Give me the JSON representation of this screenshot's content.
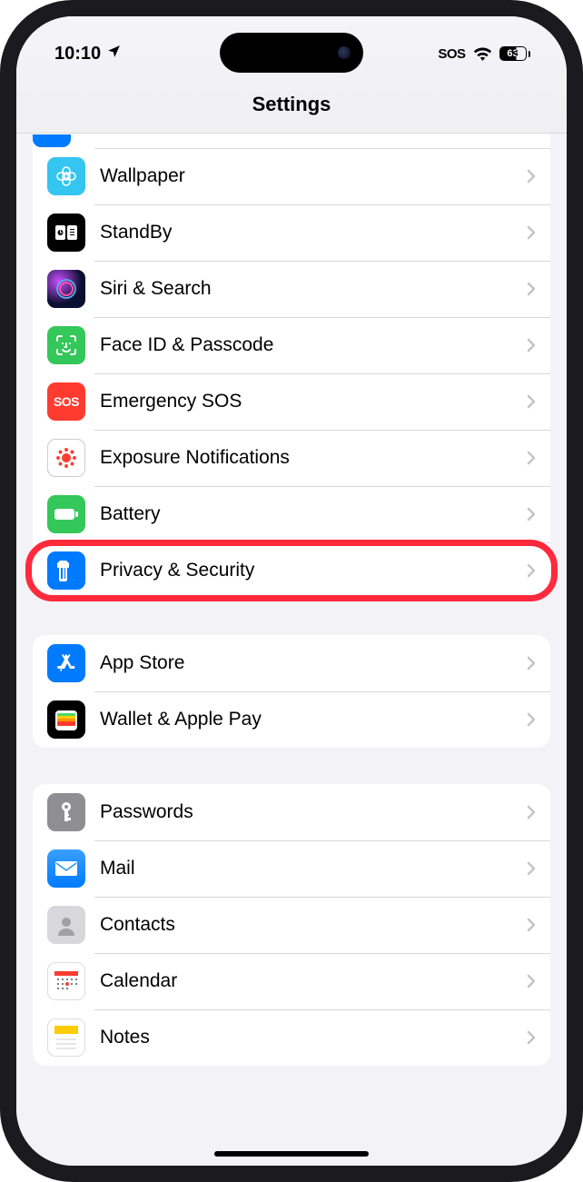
{
  "status": {
    "time": "10:10",
    "sos": "SOS",
    "battery": "63"
  },
  "header": {
    "title": "Settings"
  },
  "groups": [
    {
      "items": [
        {
          "label": "Wallpaper",
          "icon": "wallpaper-icon"
        },
        {
          "label": "StandBy",
          "icon": "standby-icon"
        },
        {
          "label": "Siri & Search",
          "icon": "siri-icon"
        },
        {
          "label": "Face ID & Passcode",
          "icon": "faceid-icon"
        },
        {
          "label": "Emergency SOS",
          "icon": "sos-icon",
          "icon_text": "SOS"
        },
        {
          "label": "Exposure Notifications",
          "icon": "exposure-icon"
        },
        {
          "label": "Battery",
          "icon": "battery-icon"
        },
        {
          "label": "Privacy & Security",
          "icon": "privacy-icon",
          "highlighted": true
        }
      ]
    },
    {
      "items": [
        {
          "label": "App Store",
          "icon": "appstore-icon"
        },
        {
          "label": "Wallet & Apple Pay",
          "icon": "wallet-icon"
        }
      ]
    },
    {
      "items": [
        {
          "label": "Passwords",
          "icon": "passwords-icon"
        },
        {
          "label": "Mail",
          "icon": "mail-icon"
        },
        {
          "label": "Contacts",
          "icon": "contacts-icon"
        },
        {
          "label": "Calendar",
          "icon": "calendar-icon"
        },
        {
          "label": "Notes",
          "icon": "notes-icon"
        }
      ]
    }
  ]
}
